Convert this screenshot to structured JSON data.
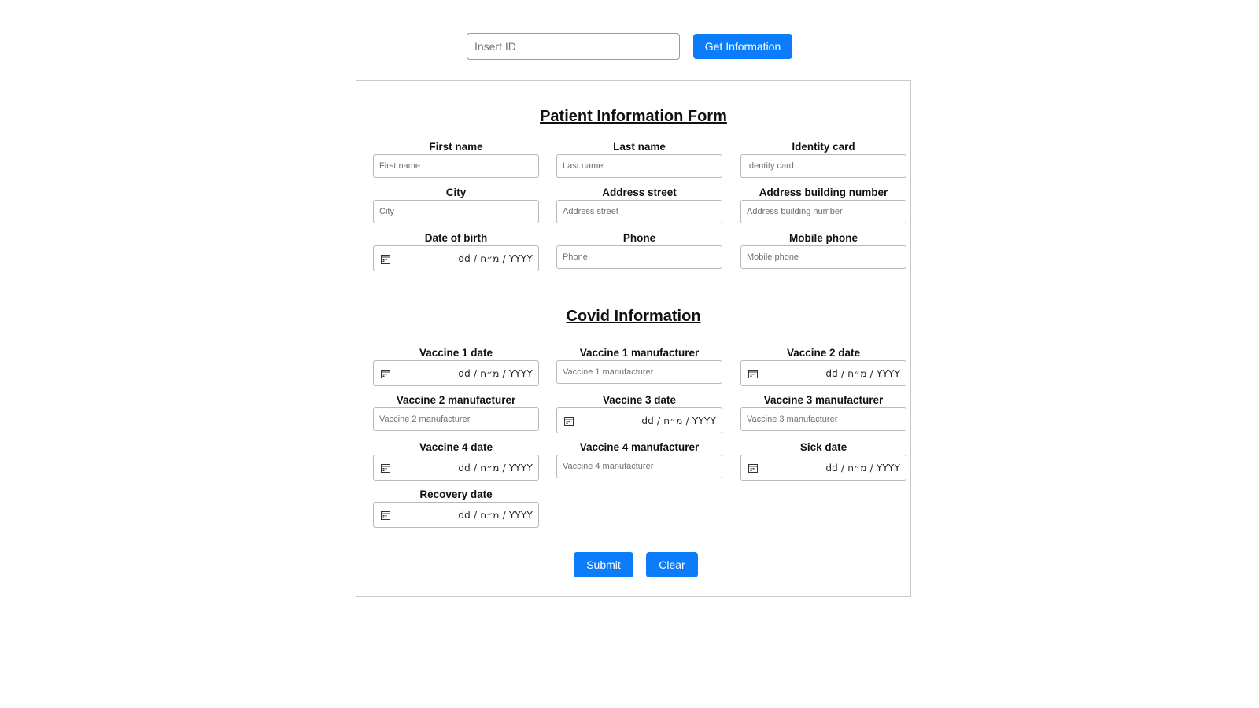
{
  "top": {
    "id_placeholder": "Insert ID",
    "get_button": "Get Information"
  },
  "colors": {
    "accent": "#0b7dfa",
    "border": "#b8b8b8"
  },
  "patient": {
    "title": "Patient Information Form",
    "first_name": {
      "label": "First name",
      "placeholder": "First name"
    },
    "last_name": {
      "label": "Last name",
      "placeholder": "Last name"
    },
    "identity_card": {
      "label": "Identity card",
      "placeholder": "Identity card"
    },
    "city": {
      "label": "City",
      "placeholder": "City"
    },
    "address_street": {
      "label": "Address street",
      "placeholder": "Address street"
    },
    "address_building": {
      "label": "Address building number",
      "placeholder": "Address building number"
    },
    "dob": {
      "label": "Date of birth",
      "format": "dd / מ״ח / YYYY"
    },
    "phone": {
      "label": "Phone",
      "placeholder": "Phone"
    },
    "mobile": {
      "label": "Mobile phone",
      "placeholder": "Mobile phone"
    }
  },
  "covid": {
    "title": "Covid Information",
    "v1_date": {
      "label": "Vaccine 1 date",
      "format": "dd / מ״ח / YYYY"
    },
    "v1_manufacturer": {
      "label": "Vaccine 1 manufacturer",
      "placeholder": "Vaccine 1 manufacturer"
    },
    "v2_date": {
      "label": "Vaccine 2 date",
      "format": "dd / מ״ח / YYYY"
    },
    "v2_manufacturer": {
      "label": "Vaccine 2 manufacturer",
      "placeholder": "Vaccine 2 manufacturer"
    },
    "v3_date": {
      "label": "Vaccine 3 date",
      "format": "dd / מ״ח / YYYY"
    },
    "v3_manufacturer": {
      "label": "Vaccine 3 manufacturer",
      "placeholder": "Vaccine 3 manufacturer"
    },
    "v4_date": {
      "label": "Vaccine 4 date",
      "format": "dd / מ״ח / YYYY"
    },
    "v4_manufacturer": {
      "label": "Vaccine 4 manufacturer",
      "placeholder": "Vaccine 4 manufacturer"
    },
    "sick_date": {
      "label": "Sick date",
      "format": "dd / מ״ח / YYYY"
    },
    "recovery_date": {
      "label": "Recovery date",
      "format": "dd / מ״ח / YYYY"
    }
  },
  "actions": {
    "submit": "Submit",
    "clear": "Clear"
  }
}
